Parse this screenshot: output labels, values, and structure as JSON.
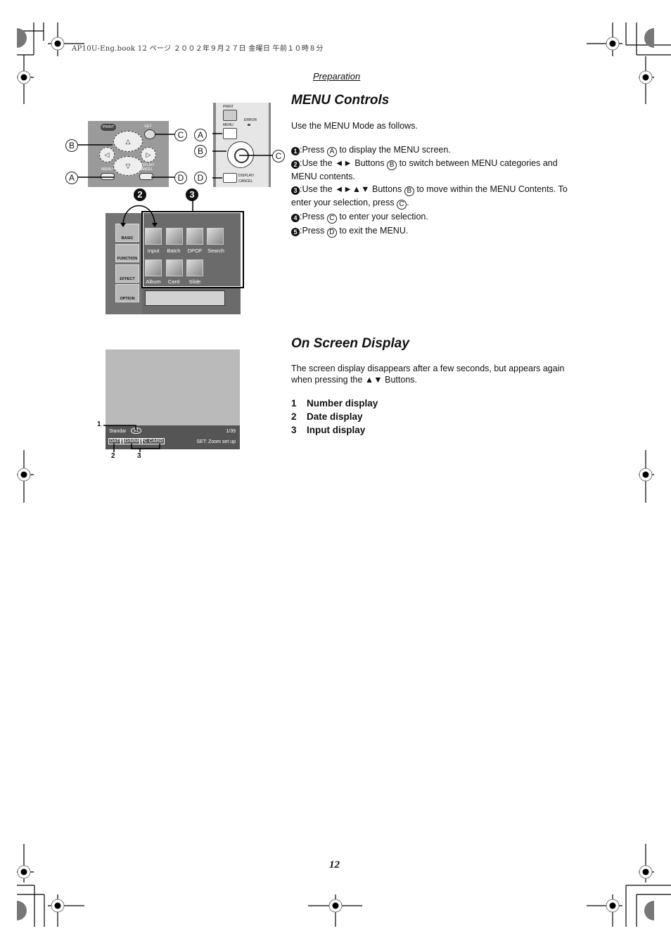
{
  "print_header": "AP10U-Eng.book  12 ページ  ２００２年９月２７日  金曜日  午前１０時８分",
  "section_label": "Preparation",
  "menu_controls": {
    "title": "MENU Controls",
    "intro": "Use the MENU Mode as follows.",
    "steps": [
      {
        "num": "1",
        "pre": ":Press ",
        "btn": "A",
        "post": " to display the MENU screen."
      },
      {
        "num": "2",
        "pre": ":Use the ◄► Buttons ",
        "btn": "B",
        "post": " to switch between MENU categories and MENU contents."
      },
      {
        "num": "3",
        "pre": ":Use the ◄►▲▼ Buttons ",
        "btn": "B",
        "post": " to move within the MENU Contents. To enter your selection, press ",
        "btn2": "C",
        "post2": "."
      },
      {
        "num": "4",
        "pre": ":Press ",
        "btn": "C",
        "post": " to enter your selection."
      },
      {
        "num": "5",
        "pre": ":Press ",
        "btn": "D",
        "post": " to exit the MENU."
      }
    ]
  },
  "remote_figure": {
    "callouts": [
      "A",
      "B",
      "C",
      "D"
    ],
    "remote_buttons": {
      "print": "PRINT",
      "set": "SET",
      "menu": "MENU",
      "display_cancel": "DISPLAY/ CANCEL",
      "up": "△",
      "down": "▽",
      "left": "◁",
      "right": "▷"
    },
    "unit_buttons": {
      "print": "PRINT",
      "menu": "MENU",
      "error": "ERROR",
      "display_cancel_1": "DISPLAY/",
      "display_cancel_2": "CANCEL"
    },
    "step_markers": [
      "2",
      "3"
    ]
  },
  "menu_screen": {
    "categories": [
      "BASIC",
      "FUNCTION",
      "EFFECT",
      "OPTION"
    ],
    "contents": [
      "Input",
      "Batch",
      "DPOF",
      "Search",
      "Album",
      "Card",
      "Slide"
    ]
  },
  "on_screen_display": {
    "title": "On Screen Display",
    "description": "The screen display disappears after a few seconds, but appears again when pressing the ▲▼ Buttons.",
    "items": [
      {
        "num": "1",
        "label": "Number display"
      },
      {
        "num": "2",
        "label": "Date display"
      },
      {
        "num": "3",
        "label": "Input display"
      }
    ],
    "screen": {
      "mode": "Standar",
      "zoom": "x1",
      "count": "1/39",
      "hint": "SET: Zoom set up",
      "tags": [
        "DATE",
        "SD/MMC",
        "PC CARD"
      ],
      "callouts": [
        "1",
        "2",
        "3"
      ]
    }
  },
  "page_number": "12"
}
